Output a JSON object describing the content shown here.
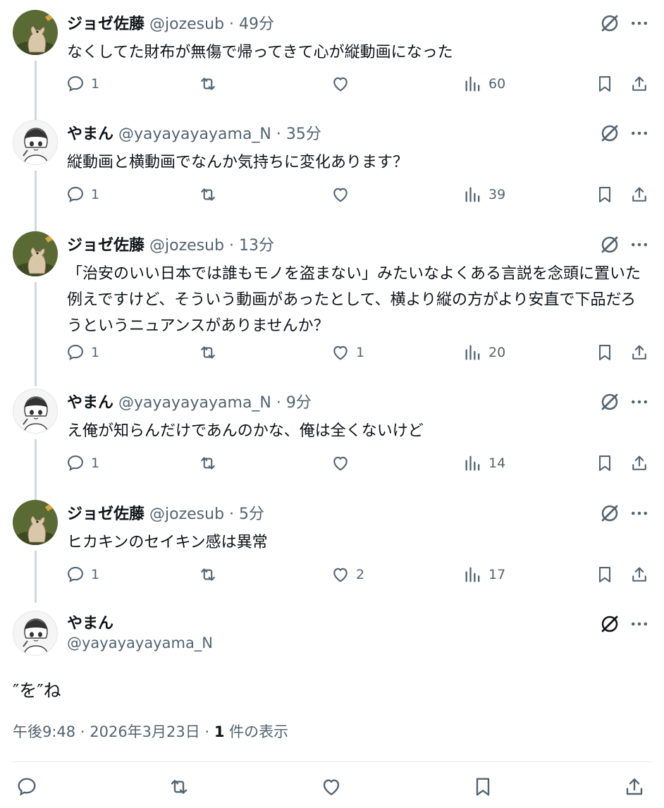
{
  "replies": [
    {
      "name": "ジョゼ佐藤",
      "handle": "@jozesub",
      "sep": "·",
      "time": "49分",
      "text": "なくしてた財布が無傷で帰ってきて心が縦動画になった",
      "replies": "1",
      "reposts": "",
      "likes": "",
      "views": "60",
      "avatar": "jozesub"
    },
    {
      "name": "やまん",
      "handle": "@yayayayayama_N",
      "sep": "·",
      "time": "35分",
      "text": "縦動画と横動画でなんか気持ちに変化あります？",
      "replies": "1",
      "reposts": "",
      "likes": "",
      "views": "39",
      "avatar": "yaya"
    },
    {
      "name": "ジョゼ佐藤",
      "handle": "@jozesub",
      "sep": "·",
      "time": "13分",
      "text": "「治安のいい日本では誰もモノを盗まない」みたいなよくある言説を念頭に置いた例えですけど、そういう動画があったとして、横より縦の方がより安直で下品だろうというニュアンスがありませんか？",
      "replies": "1",
      "reposts": "",
      "likes": "1",
      "views": "20",
      "avatar": "jozesub"
    },
    {
      "name": "やまん",
      "handle": "@yayayayayama_N",
      "sep": "·",
      "time": "9分",
      "text": "え俺が知らんだけであんのかな、俺は全くないけど",
      "replies": "1",
      "reposts": "",
      "likes": "",
      "views": "14",
      "avatar": "yaya"
    },
    {
      "name": "ジョゼ佐藤",
      "handle": "@jozesub",
      "sep": "·",
      "time": "5分",
      "text": "ヒカキンのセイキン感は異常",
      "replies": "1",
      "reposts": "",
      "likes": "2",
      "views": "17",
      "avatar": "jozesub"
    }
  ],
  "main": {
    "name": "やまん",
    "handle": "@yayayayayama_N",
    "text": "″を″ね",
    "time": "午後9:48",
    "sep": "·",
    "date": "2026年3月23日",
    "sep2": "·",
    "views_count": "1",
    "views_label": " 件の表示"
  },
  "icons": {
    "reply": "reply-icon",
    "repost": "repost-icon",
    "like": "heart-icon",
    "views": "views-icon",
    "bookmark": "bookmark-icon",
    "share": "share-icon",
    "grok": "grok-icon",
    "more": "more-icon"
  },
  "colors": {
    "text": "#0f1419",
    "secondary": "#536471",
    "thread": "#cfd9de"
  }
}
